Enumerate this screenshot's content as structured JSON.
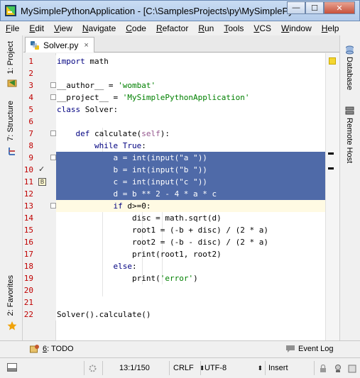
{
  "window": {
    "title": "MySimplePythonApplication - [C:\\SamplesProjects\\py\\MySimplePyt...",
    "minimize_label": "—",
    "maximize_label": "☐",
    "close_label": "✕"
  },
  "menu": [
    {
      "mnemonic": "F",
      "rest": "ile"
    },
    {
      "mnemonic": "E",
      "rest": "dit"
    },
    {
      "mnemonic": "V",
      "rest": "iew"
    },
    {
      "mnemonic": "N",
      "rest": "avigate"
    },
    {
      "mnemonic": "C",
      "rest": "ode"
    },
    {
      "mnemonic": "R",
      "rest": "efactor"
    },
    {
      "mnemonic": "R",
      "rest": "un"
    },
    {
      "mnemonic": "T",
      "rest": "ools"
    },
    {
      "mnemonic": "V",
      "rest": "CS"
    },
    {
      "mnemonic": "W",
      "rest": "indow"
    },
    {
      "mnemonic": "H",
      "rest": "elp"
    }
  ],
  "left_tabs": {
    "project": "1: Project",
    "structure": "7: Structure",
    "favorites": "2: Favorites"
  },
  "right_tabs": {
    "database": "Database",
    "remote_host": "Remote Host"
  },
  "editor_tab": {
    "filename": "Solver.py",
    "close": "×"
  },
  "code_lines": [
    "import math",
    "",
    "__author__ = 'wombat'",
    "__project__ = 'MySimplePythonApplication'",
    "class Solver:",
    "",
    "    def calculate(self):",
    "        while True:",
    "            a = int(input(\"a \"))",
    "            b = int(input(\"b \"))",
    "            c = int(input(\"c \"))",
    "            d = b ** 2 - 4 * a * c",
    "            if d>=0:",
    "                disc = math.sqrt(d)",
    "                root1 = (-b + disc) / (2 * a)",
    "                root2 = (-b - disc) / (2 * a)",
    "                print(root1, root2)",
    "            else:",
    "                print('error')",
    "",
    "",
    "Solver().calculate()"
  ],
  "bottom": {
    "todo_num": "6",
    "todo_label": ": TODO",
    "event_log": "Event Log"
  },
  "status": {
    "position": "13:1/150",
    "line_sep": "CRLF",
    "encoding": "UTF-8",
    "mode": "Insert"
  },
  "colors": {
    "selection": "#4f6aa8",
    "caret_row": "#fffae3",
    "line_numbers": "#c00000"
  }
}
